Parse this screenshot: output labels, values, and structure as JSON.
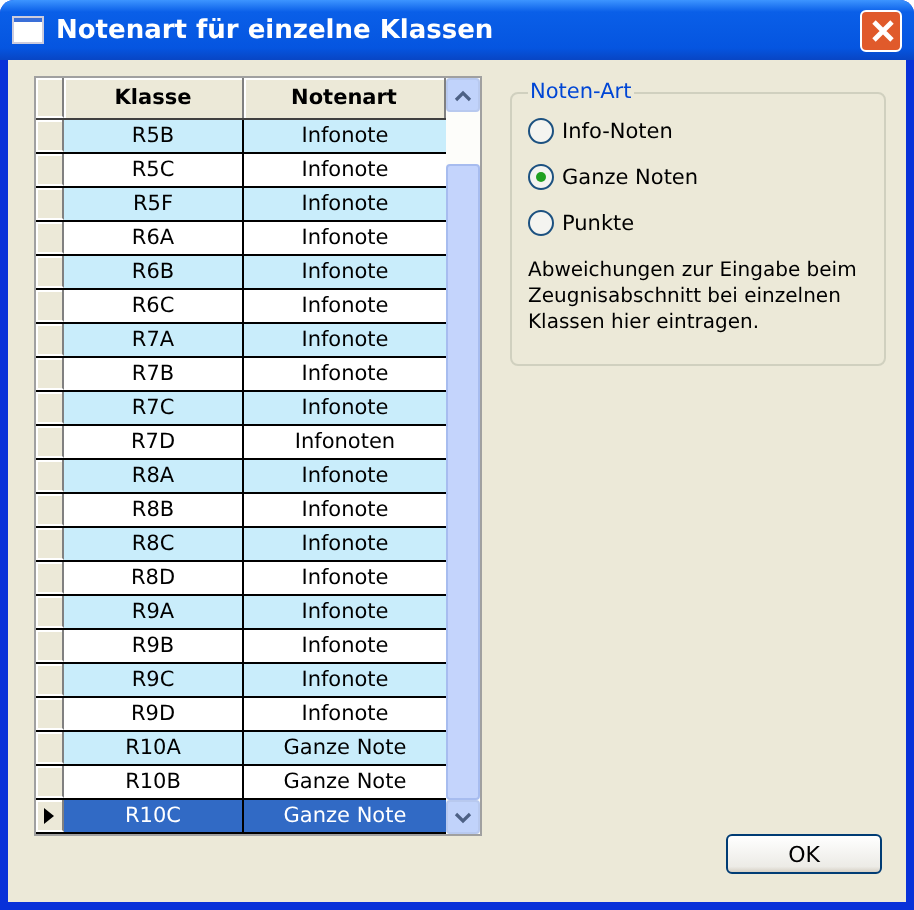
{
  "window": {
    "title": "Notenart für einzelne Klassen"
  },
  "table": {
    "columns": [
      "Klasse",
      "Notenart"
    ],
    "rows": [
      {
        "cells": [
          "R5B",
          "Infonote"
        ],
        "selected": false
      },
      {
        "cells": [
          "R5C",
          "Infonote"
        ],
        "selected": false
      },
      {
        "cells": [
          "R5F",
          "Infonote"
        ],
        "selected": false
      },
      {
        "cells": [
          "R6A",
          "Infonote"
        ],
        "selected": false
      },
      {
        "cells": [
          "R6B",
          "Infonote"
        ],
        "selected": false
      },
      {
        "cells": [
          "R6C",
          "Infonote"
        ],
        "selected": false
      },
      {
        "cells": [
          "R7A",
          "Infonote"
        ],
        "selected": false
      },
      {
        "cells": [
          "R7B",
          "Infonote"
        ],
        "selected": false
      },
      {
        "cells": [
          "R7C",
          "Infonote"
        ],
        "selected": false
      },
      {
        "cells": [
          "R7D",
          "Infonoten"
        ],
        "selected": false
      },
      {
        "cells": [
          "R8A",
          "Infonote"
        ],
        "selected": false
      },
      {
        "cells": [
          "R8B",
          "Infonote"
        ],
        "selected": false
      },
      {
        "cells": [
          "R8C",
          "Infonote"
        ],
        "selected": false
      },
      {
        "cells": [
          "R8D",
          "Infonote"
        ],
        "selected": false
      },
      {
        "cells": [
          "R9A",
          "Infonote"
        ],
        "selected": false
      },
      {
        "cells": [
          "R9B",
          "Infonote"
        ],
        "selected": false
      },
      {
        "cells": [
          "R9C",
          "Infonote"
        ],
        "selected": false
      },
      {
        "cells": [
          "R9D",
          "Infonote"
        ],
        "selected": false
      },
      {
        "cells": [
          "R10A",
          "Ganze Note"
        ],
        "selected": false
      },
      {
        "cells": [
          "R10B",
          "Ganze Note"
        ],
        "selected": false
      },
      {
        "cells": [
          "R10C",
          "Ganze Note"
        ],
        "selected": true
      }
    ]
  },
  "group": {
    "title": "Noten-Art",
    "options": [
      {
        "label": "Info-Noten",
        "selected": false
      },
      {
        "label": "Ganze Noten",
        "selected": true
      },
      {
        "label": "Punkte",
        "selected": false
      }
    ],
    "note": "Abweichungen zur Eingabe beim Zeugnisabschnitt bei einzelnen Klassen hier eintragen."
  },
  "buttons": [
    "OK"
  ]
}
